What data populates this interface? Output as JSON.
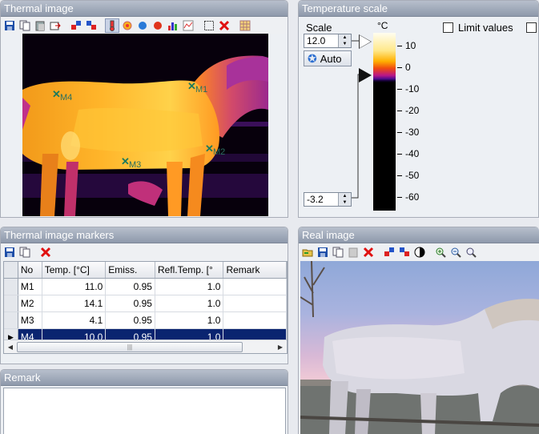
{
  "thermal_panel": {
    "title": "Thermal image",
    "markers": [
      {
        "label": "M1"
      },
      {
        "label": "M2"
      },
      {
        "label": "M3"
      },
      {
        "label": "M4"
      }
    ]
  },
  "temp_panel": {
    "title": "Temperature scale",
    "scale_label": "Scale",
    "scale_max": "12.0",
    "scale_min": "-3.2",
    "auto_label": "Auto",
    "limit_label": "Limit values",
    "unit": "°C",
    "ticks": [
      "10",
      "0",
      "-10",
      "-20",
      "-30",
      "-40",
      "-50",
      "-60"
    ]
  },
  "markers_panel": {
    "title": "Thermal image markers",
    "columns": [
      "No",
      "Temp. [°C]",
      "Emiss.",
      "Refl.Temp. [°",
      "Remark"
    ],
    "rows": [
      {
        "no": "M1",
        "temp": "11.0",
        "emiss": "0.95",
        "refl": "1.0",
        "remark": ""
      },
      {
        "no": "M2",
        "temp": "14.1",
        "emiss": "0.95",
        "refl": "1.0",
        "remark": ""
      },
      {
        "no": "M3",
        "temp": "4.1",
        "emiss": "0.95",
        "refl": "1.0",
        "remark": ""
      },
      {
        "no": "M4",
        "temp": "10.0",
        "emiss": "0.95",
        "refl": "1.0",
        "remark": ""
      }
    ],
    "selected_row": "M4"
  },
  "remark_panel": {
    "title": "Remark",
    "text": ""
  },
  "real_panel": {
    "title": "Real image"
  }
}
